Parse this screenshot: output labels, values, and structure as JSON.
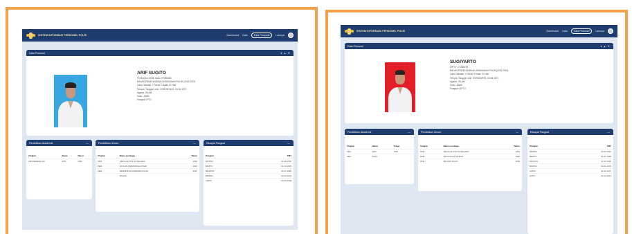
{
  "colors": {
    "frame": "#f0a14a",
    "navbar": "#1f3c6e",
    "page_bg": "#dfe8f2"
  },
  "navbar": {
    "app_title": "SISTEM INFORMASI PERSONEL POLRI",
    "item_1": "Dashboard",
    "item_2": "Data",
    "active_button": "Data Personel",
    "item_4": "Lainnya"
  },
  "profile_card": {
    "header": "Data Personel",
    "controls": "▾ ▴ ✕"
  },
  "panel_controls": "—",
  "screen_a": {
    "name": "ARIF SUGITO",
    "details": [
      "Pembantu Letnan Satu / 67080483",
      "BADAN PEMELIHARAAN KEAMANAN POLRI (2015-2022)",
      "Lama Jabatan: 2 Tahun 2 Bulan 12 Hari",
      "Tempat, Tanggal Lahir: GORONTALO, 10-04-1970",
      "Agama: ISLAM",
      "Suku: JAWA",
      "Pangkat: IPTU"
    ],
    "edu_title": "Pendidikan Akademik",
    "edu_headers": [
      "Tingkat",
      "Nama",
      "Tahun"
    ],
    "edu_rows": [
      [
        "SMA/SEDERAJAT",
        "SMA",
        "1989"
      ]
    ],
    "train_title": "Pendidikan Umum",
    "train_headers": [
      "Tingkat",
      "Nama Lembaga",
      "Tahun"
    ],
    "train_rows": [
      [
        "PEM",
        "SEKOLAH POLISI NEGARA",
        "1990"
      ],
      [
        "PEM",
        "SATUAN PENDIDIKAN POLRI",
        "2004"
      ],
      [
        "PEM",
        "PENDIDIKAN PERWIRA POLRI",
        "2010"
      ],
      [
        "",
        "POLDA",
        ""
      ]
    ],
    "rank_title": "Riwayat Pangkat",
    "rank_headers": [
      "Pangkat",
      "TMT"
    ],
    "rank_rows": [
      [
        "BRIPDA",
        "01-08-1990"
      ],
      [
        "BRIPTU",
        "01-10-1995"
      ],
      [
        "BRIGPOL",
        "01-07-1999"
      ],
      [
        "BRIPKA",
        "01-04-2004"
      ],
      [
        "AIPDA",
        "01-04-2008"
      ]
    ]
  },
  "screen_b": {
    "name": "SUGIYARTO",
    "details": [
      "AIPTU / 71080192",
      "BADAN PEMELIHARAAN KEAMANAN POLRI (2016-2019)",
      "Lama Jabatan: 4 Tahun 3 Bulan 10 Hari",
      "Tempat, Tanggal Lahir: SURAKARTA, 22-08-1971",
      "Agama: ISLAM",
      "Suku: JAWA",
      "Pangkat: AIPTU"
    ],
    "edu_title": "Pendidikan Akademik",
    "edu_headers": [
      "Tingkat",
      "Nama",
      "Tahun"
    ],
    "edu_rows": [
      [
        "SMA",
        "SMA",
        "1990"
      ],
      [
        "SMA",
        "PGRI",
        ""
      ]
    ],
    "train_title": "Pendidikan Umum",
    "train_headers": [
      "Tingkat",
      "Nama Lembaga",
      "Tahun"
    ],
    "train_rows": [
      [
        "PEM",
        "SEKOLAH POLISI NEGARA",
        "1991"
      ],
      [
        "PEM",
        "SPN POLDA JATENG",
        "1995"
      ],
      [
        "PEM",
        "SECAPA POLRI",
        "2009"
      ]
    ],
    "rank_title": "Riwayat Pangkat",
    "rank_headers": [
      "Pangkat",
      "TMT"
    ],
    "rank_rows": [
      [
        "BRIPDA",
        "01-05-1991"
      ],
      [
        "BRIPTU",
        "01-01-1995"
      ],
      [
        "BRIGPOL",
        "01-01-1999"
      ],
      [
        "BRIPKA",
        "01-01-2003"
      ],
      [
        "AIPDA",
        "01-01-2007"
      ],
      [
        "AIPTU",
        "01-01-2011"
      ]
    ]
  }
}
